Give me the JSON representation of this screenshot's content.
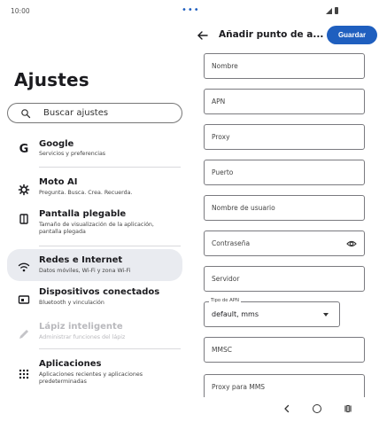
{
  "status_bar": {
    "time": "10:00",
    "dots": "•••"
  },
  "left": {
    "title": "Ajustes",
    "search_placeholder": "Buscar ajustes",
    "items": [
      {
        "icon": "google-icon",
        "title": "Google",
        "subtitle": "Servicios y preferencias"
      },
      {
        "icon": "moto-ai-icon",
        "title": "Moto AI",
        "subtitle": "Pregunta. Busca. Crea. Recuerda."
      },
      {
        "icon": "foldable-screen-icon",
        "title": "Pantalla plegable",
        "subtitle": "Tamaño de visualización de la aplicación, pantalla plegada"
      },
      {
        "icon": "wifi-icon",
        "title": "Redes e Internet",
        "subtitle": "Datos móviles, Wi-Fi y zona Wi-Fi"
      },
      {
        "icon": "connected-devices-icon",
        "title": "Dispositivos conectados",
        "subtitle": "Bluetooth y vinculación"
      },
      {
        "icon": "pen-icon",
        "title": "Lápiz inteligente",
        "subtitle": "Administrar funciones del lápiz"
      },
      {
        "icon": "apps-icon",
        "title": "Aplicaciones",
        "subtitle": "Aplicaciones recientes y aplicaciones predeterminadas"
      }
    ]
  },
  "right": {
    "title": "Añadir punto de a...",
    "save_label": "Guardar",
    "fields": {
      "nombre": "Nombre",
      "apn": "APN",
      "proxy": "Proxy",
      "puerto": "Puerto",
      "usuario": "Nombre de usuario",
      "contrasena": "Contraseña",
      "servidor": "Servidor",
      "mmsc": "MMSC",
      "proxy_mms": "Proxy para MMS"
    },
    "apn_type": {
      "label": "Tipo de APN",
      "value": "default, mms"
    }
  },
  "colors": {
    "accent": "#1f5fbf",
    "selected_bg": "#e9ebf0"
  }
}
